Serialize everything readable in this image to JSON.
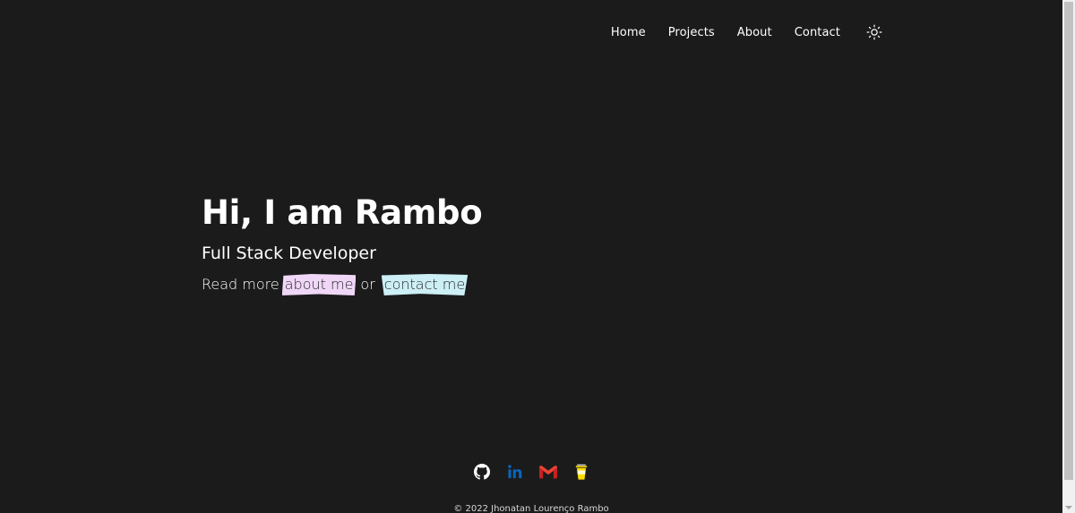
{
  "nav": {
    "items": [
      {
        "label": "Home"
      },
      {
        "label": "Projects"
      },
      {
        "label": "About"
      },
      {
        "label": "Contact"
      }
    ],
    "theme_toggle_icon": "sun-icon"
  },
  "hero": {
    "title": "Hi, I am Rambo",
    "subtitle": "Full Stack Developer",
    "readmore_prefix": "Read more",
    "about_link": "about me",
    "connector": "or",
    "contact_link": "contact me"
  },
  "footer": {
    "socials": [
      {
        "icon": "github-icon"
      },
      {
        "icon": "linkedin-icon"
      },
      {
        "icon": "gmail-icon"
      },
      {
        "icon": "buymeacoffee-icon"
      }
    ],
    "copyright": "© 2022 Jhonatan Lourenço Rambo"
  },
  "colors": {
    "background": "#1b1b1b",
    "text": "#ffffff",
    "about_highlight": "#f0d7f7",
    "contact_highlight": "#cdeff6",
    "linkedin": "#0a66c2",
    "gmail": "#ea4335",
    "coffee": "#ffdd00"
  }
}
